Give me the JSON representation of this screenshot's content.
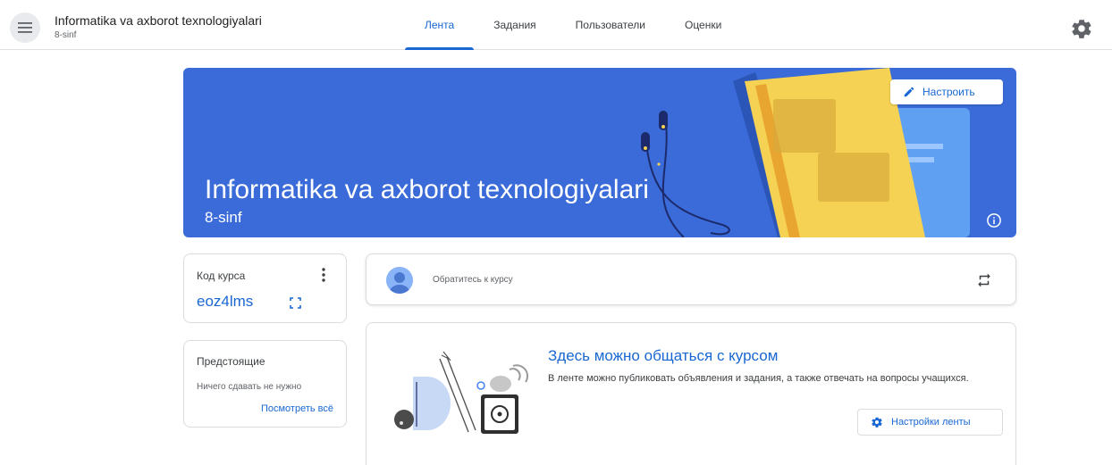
{
  "header": {
    "course_title": "Informatika va axborot texnologiyalari",
    "course_section": "8-sinf",
    "tabs": [
      {
        "label": "Лента",
        "active": true
      },
      {
        "label": "Задания",
        "active": false
      },
      {
        "label": "Пользователи",
        "active": false
      },
      {
        "label": "Оценки",
        "active": false
      }
    ],
    "icons": {
      "menu": "hamburger-menu-icon",
      "settings": "gear-icon"
    }
  },
  "banner": {
    "title": "Informatika va axborot texnologiyalari",
    "section": "8-sinf",
    "customize_label": "Настроить",
    "background_color": "#3a6bd8",
    "icons": {
      "customize": "pencil-icon",
      "info": "info-icon"
    }
  },
  "course_code": {
    "label": "Код курса",
    "value": "eoz4lms",
    "icons": {
      "more": "more-vert-icon",
      "expand": "fullscreen-icon"
    }
  },
  "upcoming": {
    "title": "Предстоящие",
    "empty_text": "Ничего сдавать не нужно",
    "link_label": "Посмотреть всё"
  },
  "announce": {
    "placeholder": "Обратитесь к курсу",
    "icons": {
      "avatar": "avatar-icon",
      "repost": "repost-icon"
    }
  },
  "stream": {
    "title": "Здесь можно общаться с курсом",
    "description": "В ленте можно публиковать объявления и задания, а также отвечать на вопросы учащихся.",
    "settings_label": "Настройки ленты",
    "icons": {
      "settings": "gear-icon"
    }
  },
  "colors": {
    "accent": "#1967d2",
    "banner": "#3a6bd8"
  }
}
